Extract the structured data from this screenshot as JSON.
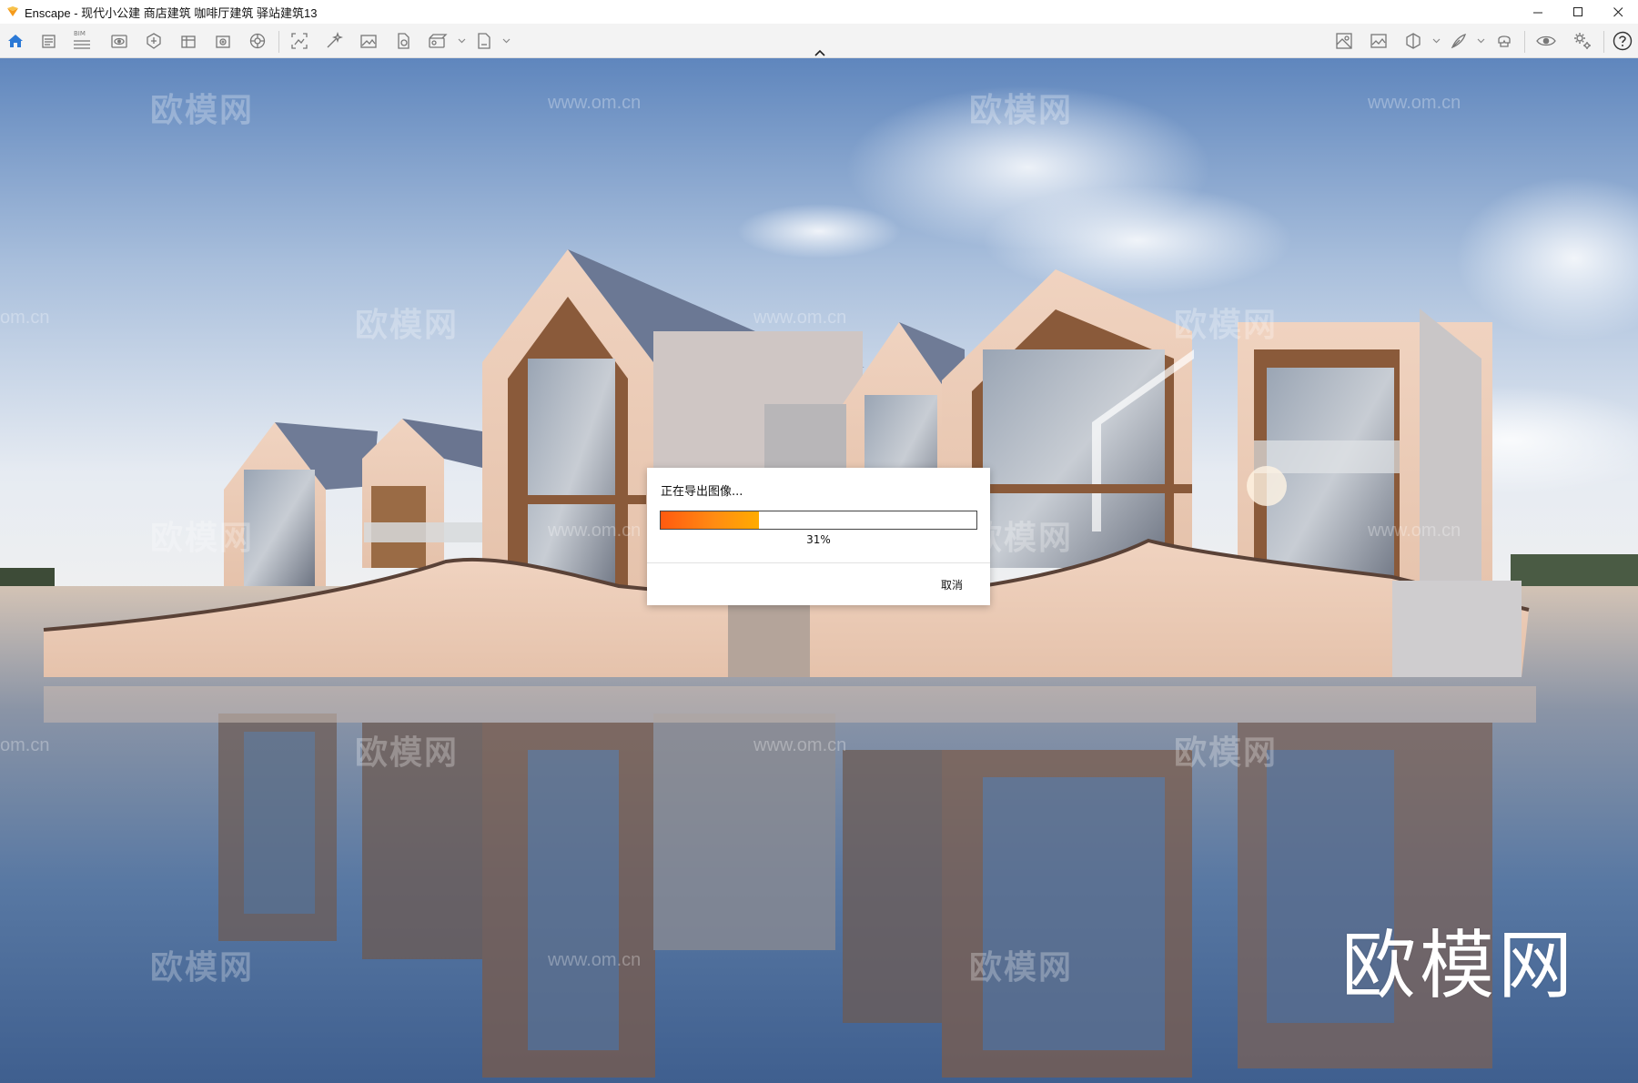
{
  "window": {
    "app_name": "Enscape",
    "title": "Enscape - 现代小公建 商店建筑 咖啡厅建筑 驿站建筑13",
    "controls": [
      "minimize",
      "maximize",
      "close"
    ]
  },
  "toolbar": {
    "left_icons": [
      "home-icon",
      "views-icon",
      "bim-icon",
      "visual-settings-icon",
      "asset-library-icon",
      "material-editor-icon",
      "asset-editor-icon",
      "atmosphere-icon",
      "screenshot-icon",
      "batch-render-icon",
      "gallery-icon",
      "export-icon",
      "video-editor-icon",
      "web-standalone-icon"
    ],
    "right_icons": [
      "minimap-icon",
      "site-context-icon",
      "section-icon",
      "annotation-icon",
      "vr-headset-icon",
      "view-toggle-icon",
      "settings-icon",
      "help-icon"
    ],
    "bim_badge": "BIM"
  },
  "dialog": {
    "title": "正在导出图像...",
    "progress_percent": 31,
    "progress_label": "31%",
    "cancel_label": "取消"
  },
  "watermarks": {
    "site": "www.om.cn",
    "site_partial": "om.cn",
    "brand": "欧模网"
  },
  "colors": {
    "progress_start": "#ff5a10",
    "progress_end": "#ffab00",
    "toolbar_accent": "#2b79d6"
  }
}
